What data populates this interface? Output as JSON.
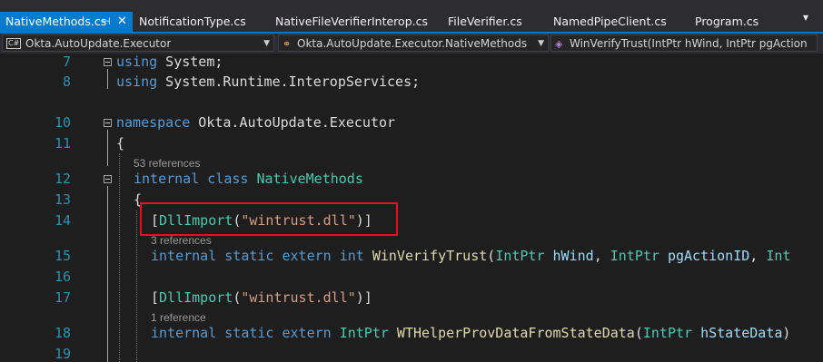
{
  "tabs": [
    {
      "label": "NativeMethods.cs",
      "active": true,
      "pin_icon": "pin-icon",
      "close_icon": "close-icon"
    },
    {
      "label": "NotificationType.cs"
    },
    {
      "label": "NativeFileVerifierInterop.cs"
    },
    {
      "label": "FileVerifier.cs"
    },
    {
      "label": "NamedPipeClient.cs"
    },
    {
      "label": "Program.cs"
    }
  ],
  "navbar": {
    "project": {
      "icon": "csharp-project-icon",
      "text": "Okta.AutoUpdate.Executor"
    },
    "type": {
      "icon": "class-icon",
      "text": "Okta.AutoUpdate.Executor.NativeMethods"
    },
    "member": {
      "icon": "method-icon",
      "text": "WinVerifyTrust(IntPtr hWind, IntPtr pgActionID, In"
    }
  },
  "editor": {
    "line_numbers": [
      "7",
      "8",
      "10",
      "11",
      "12",
      "13",
      "14",
      "15",
      "16",
      "17",
      "18",
      "19"
    ],
    "codelens": [
      "53 references",
      "3 references",
      "1 reference"
    ],
    "code": {
      "l7_kw": "using",
      "l7_rest": " System;",
      "l8_kw": "using",
      "l8_rest": " System.Runtime.InteropServices;",
      "l10_kw": "namespace",
      "l10_rest": " Okta.AutoUpdate.Executor",
      "l11": "{",
      "l12_kw1": "internal",
      "l12_kw2": " class ",
      "l12_type": "NativeMethods",
      "l13": "{",
      "l14_open": "[",
      "l14_attr": "DllImport",
      "l14_paren": "(",
      "l14_str": "\"wintrust.dll\"",
      "l14_close": ")]",
      "l15_kw": "internal static extern ",
      "l15_int": "int",
      "l15_fn": " WinVerifyTrust",
      "l15_p1": "(",
      "l15_t1": "IntPtr",
      "l15_n1": " hWind",
      "l15_c1": ", ",
      "l15_t2": "IntPtr",
      "l15_n2": " pgActionID",
      "l15_c2": ", ",
      "l15_t3": "Int",
      "l17_open": "[",
      "l17_attr": "DllImport",
      "l17_paren": "(",
      "l17_str": "\"wintrust.dll\"",
      "l17_close": ")]",
      "l18_kw": "internal static extern ",
      "l18_type": "IntPtr",
      "l18_fn": " WTHelperProvDataFromStateData",
      "l18_p1": "(",
      "l18_t1": "IntPtr",
      "l18_n1": " hStateData",
      "l18_close": ")"
    }
  },
  "highlight": {
    "color": "#e81123"
  }
}
